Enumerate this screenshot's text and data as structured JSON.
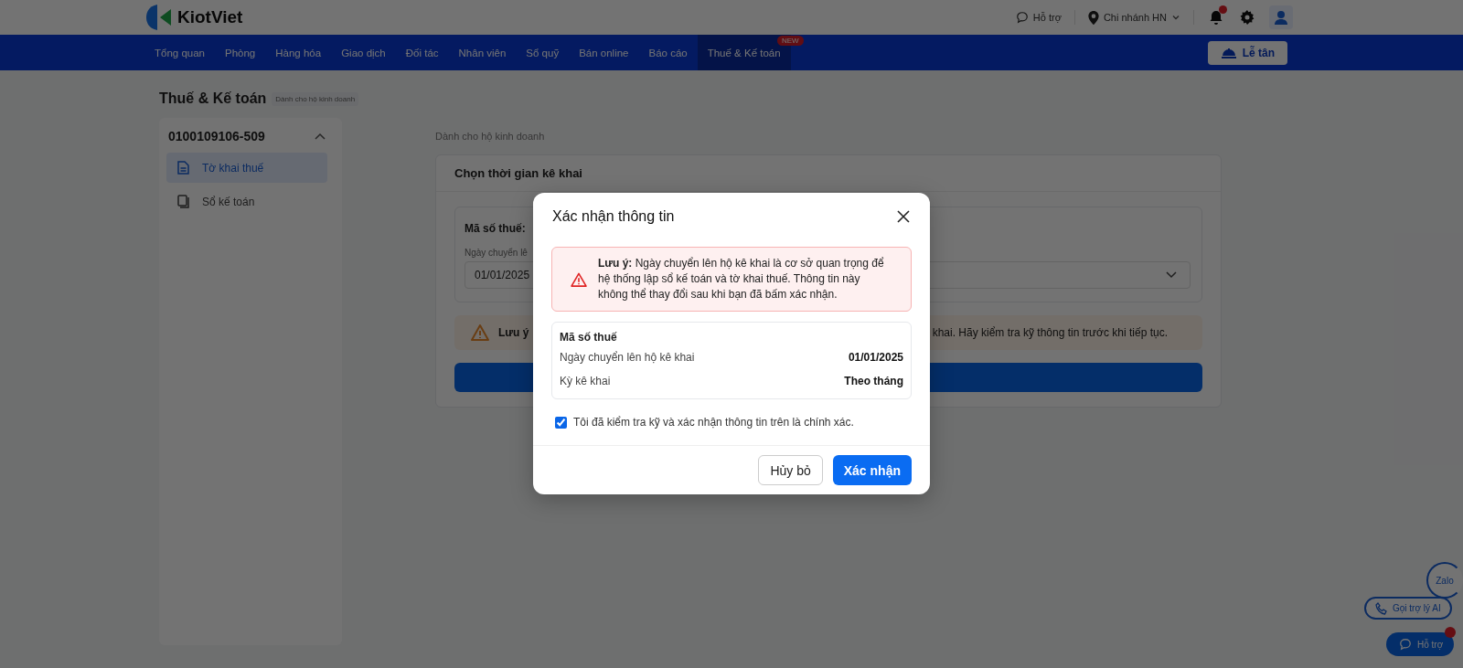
{
  "header": {
    "logo_text": "KiotViet",
    "support_label": "Hỗ trợ",
    "branch": "Chi nhánh HN",
    "notification_dot": true
  },
  "nav": {
    "items": [
      {
        "label": "Tổng quan",
        "selected": false
      },
      {
        "label": "Phòng",
        "selected": false
      },
      {
        "label": "Hàng hóa",
        "selected": false
      },
      {
        "label": "Giao dịch",
        "selected": false
      },
      {
        "label": "Đối tác",
        "selected": false
      },
      {
        "label": "Nhân viên",
        "selected": false
      },
      {
        "label": "Sổ quỹ",
        "selected": false
      },
      {
        "label": "Bán online",
        "selected": false
      },
      {
        "label": "Báo cáo",
        "selected": false
      },
      {
        "label": "Thuế & Kế toán",
        "selected": true,
        "badge": "NEW"
      }
    ],
    "reception_button": "Lễ tân"
  },
  "page": {
    "title": "Thuế & Kế toán",
    "subtitle": "Dành cho hộ kinh doanh",
    "sidebar": {
      "account": "0100109106-509",
      "expanded": true,
      "items": [
        {
          "label": "Tờ khai thuế",
          "kind": "form",
          "selected": true
        },
        {
          "label": "Sổ kế toán",
          "kind": "ledger",
          "selected": false
        }
      ]
    },
    "main": {
      "caption": "Dành cho hộ kinh doanh",
      "card_title": "Chọn thời gian kê khai",
      "tax_code_label": "Mã số thuế:",
      "date_label": "Ngày chuyển lê",
      "date_value": "01/01/2025",
      "warning_label": "Lưu ý",
      "warning_text": "khai. Hãy kiểm tra kỹ thông tin trước khi tiếp tục."
    }
  },
  "modal": {
    "title": "Xác nhận thông tin",
    "alert": "**Lưu ý:** Ngày chuyển lên hộ kê khai là cơ sở quan trọng để hệ thống lập sổ kế toán và tờ khai thuế. Thông tin này không thể thay đổi sau khi bạn đã bấm xác nhận.",
    "summary": {
      "heading": "Mã số thuế",
      "rows": [
        {
          "label": "Ngày chuyển lên hộ kê khai",
          "value": "01/01/2025"
        },
        {
          "label": "Kỳ kê khai",
          "value": "Theo tháng"
        }
      ]
    },
    "confirm": {
      "label": "Tôi đã kiểm tra kỹ và xác nhận thông tin trên là chính xác.",
      "checked": true
    },
    "buttons": [
      {
        "label": "Hủy bỏ",
        "kind": "secondary"
      },
      {
        "label": "Xác nhận",
        "kind": "primary"
      }
    ]
  },
  "floating": {
    "zalo_label": "Zalo",
    "ai_button": "Gọi trợ lý AI",
    "support_button": "Hỗ trợ",
    "support_dot": true
  }
}
